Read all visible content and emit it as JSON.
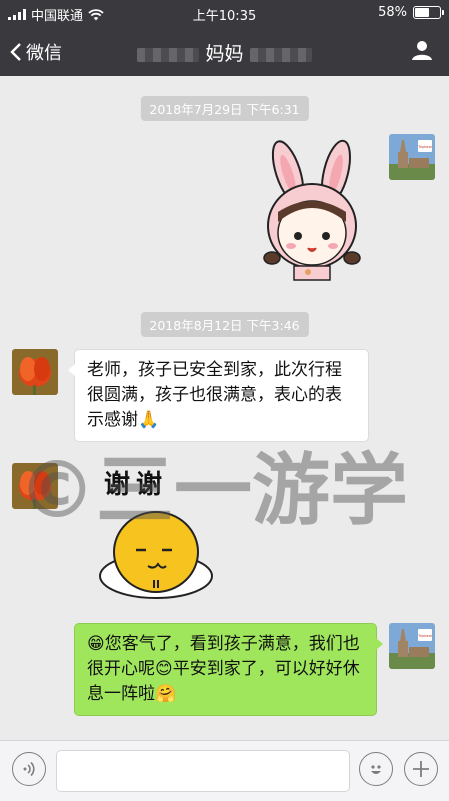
{
  "status_bar": {
    "carrier": "中国联通",
    "time": "上午10:35",
    "battery_percent": "58%",
    "battery_level": 0.58
  },
  "nav": {
    "back_label": "微信",
    "title": "妈妈"
  },
  "messages": {
    "ts1": "2018年7月29日 下午6:31",
    "ts2": "2018年8月12日 下午3:46",
    "msg1": "老师，孩子已安全到家，此次行程很圆满，孩子也很满意，表心的表示感谢🙏",
    "sticker2_text": "谢谢",
    "msg3": "😁您客气了，看到孩子满意，我们也很开心呢😊平安到家了，可以好好休息一阵啦🤗"
  },
  "watermark": "©三一游学",
  "avatar_badge": "Tripbest",
  "colors": {
    "nav_bg": "#3a3a3e",
    "chat_bg": "#ebebeb",
    "bubble_right": "#9fe65c",
    "bubble_left": "#ffffff"
  }
}
